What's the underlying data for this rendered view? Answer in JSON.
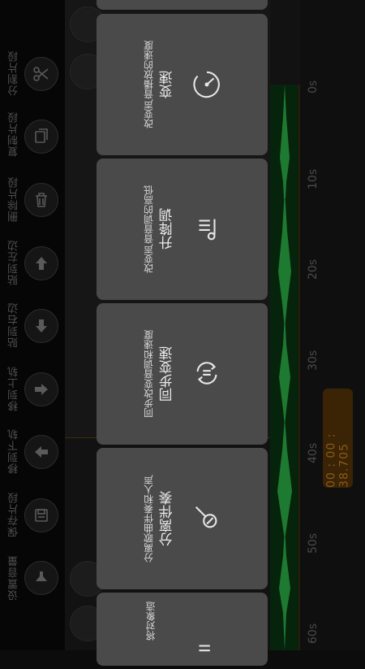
{
  "toolbar": {
    "items": [
      {
        "label": "分割片段",
        "icon": "scissors-icon"
      },
      {
        "label": "复制片段",
        "icon": "copy-icon"
      },
      {
        "label": "删除片段",
        "icon": "trash-icon"
      },
      {
        "label": "贴到左边",
        "icon": "arrow-up-icon"
      },
      {
        "label": "贴到右边",
        "icon": "arrow-down-icon"
      },
      {
        "label": "移到上轨",
        "icon": "arrow-right-icon"
      },
      {
        "label": "移到下轨",
        "icon": "arrow-left-icon"
      },
      {
        "label": "保存片段",
        "icon": "save-icon"
      },
      {
        "label": "设置音量",
        "icon": "volume-icon"
      }
    ]
  },
  "ruler": {
    "ticks": [
      "0s",
      "10s",
      "20s",
      "30s",
      "40s",
      "50s",
      "60s"
    ],
    "current_time": "00 : 00 : 38.705"
  },
  "menu": {
    "cards": [
      {
        "title": "变速",
        "desc": "改变声音播放的速度",
        "icon": "speed-gauge-icon"
      },
      {
        "title": "升降调",
        "desc": "改变声音音调的高低",
        "icon": "pitch-icon"
      },
      {
        "title": "同步变速",
        "desc": "同步改变音调和速度",
        "icon": "sync-icon"
      },
      {
        "title": "分离伴奏",
        "desc": "分离歌曲伴奏和人声",
        "icon": "microphone-icon"
      },
      {
        "title": "",
        "desc": "将对象造",
        "icon": "partial-icon"
      }
    ]
  },
  "colors": {
    "card_bg": "#4a4a4a",
    "waveform": "#1e7a30",
    "time_badge": "#3a2405"
  }
}
